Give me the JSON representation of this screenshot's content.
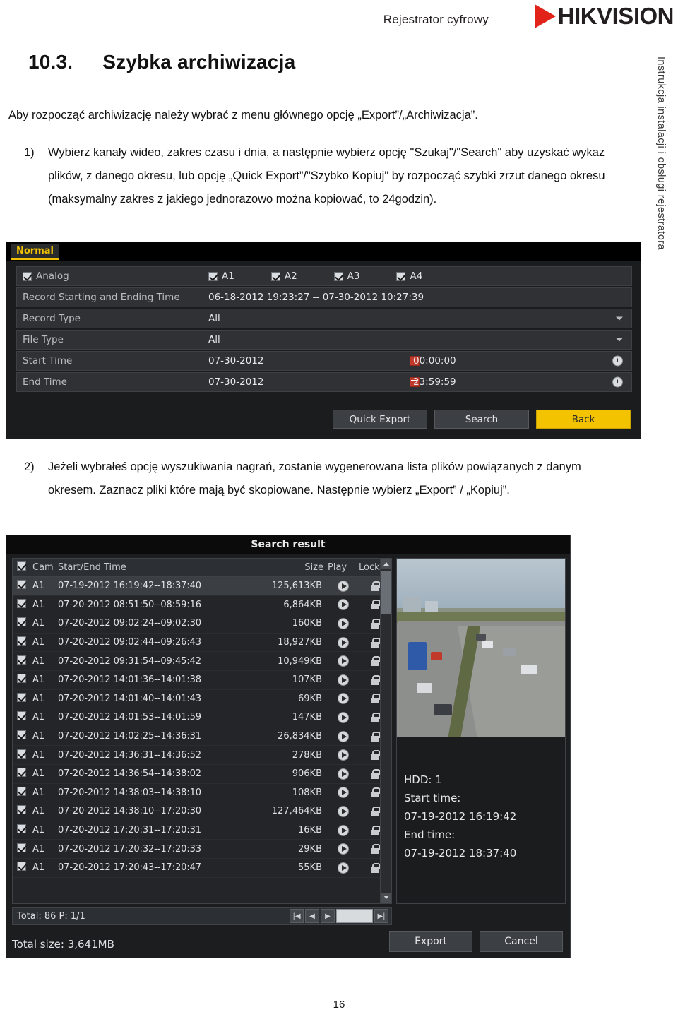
{
  "header": {
    "product_text": "Rejestrator  cyfrowy",
    "brand": "HIKVISION",
    "side_text": "Instrukcja instalacji i obsługi rejestratora"
  },
  "title": {
    "number": "10.3.",
    "text": "Szybka archiwizacja"
  },
  "lead": "Aby rozpocząć archiwizację należy wybrać z menu głównego opcję „Export”/„Archiwizacja”.",
  "item1": {
    "marker": "1)",
    "text": "Wybierz kanały wideo, zakres czasu i dnia, a następnie wybierz opcję \"Szukaj\"/\"Search\" aby uzyskać wykaz plików, z danego okresu, lub opcję „Quick Export”/\"Szybko Kopiuj\" by rozpocząć szybki zrzut danego okresu (maksymalny zakres z jakiego jednorazowo można kopiować, to 24godzin)."
  },
  "item2": {
    "marker": "2)",
    "text": "Jeżeli wybrałeś opcję wyszukiwania nagrań, zostanie wygenerowana lista plików powiązanych z danym okresem. Zaznacz pliki które mają być skopiowane. Następnie wybierz „Export” / „Kopiuj”."
  },
  "export_panel": {
    "tab": "Normal",
    "analog_label": "Analog",
    "channels": [
      "A1",
      "A2",
      "A3",
      "A4"
    ],
    "rows": [
      {
        "label": "Record Starting and Ending Time",
        "value": "06-18-2012 19:23:27  --  07-30-2012 10:27:39"
      },
      {
        "label": "Record Type",
        "value": "All"
      },
      {
        "label": "File Type",
        "value": "All"
      },
      {
        "label": "Start Time",
        "value": "07-30-2012",
        "time": "00:00:00"
      },
      {
        "label": "End Time",
        "value": "07-30-2012",
        "time": "23:59:59"
      }
    ],
    "buttons": {
      "quick_export": "Quick Export",
      "search": "Search",
      "back": "Back"
    }
  },
  "search_window": {
    "title": "Search result",
    "columns": {
      "cam": "Cam",
      "time": "Start/End Time",
      "size": "Size",
      "play": "Play",
      "lock": "Lock"
    },
    "rows": [
      {
        "cam": "A1",
        "time": "07-19-2012 16:19:42--18:37:40",
        "size": "125,613KB"
      },
      {
        "cam": "A1",
        "time": "07-20-2012 08:51:50--08:59:16",
        "size": "6,864KB"
      },
      {
        "cam": "A1",
        "time": "07-20-2012 09:02:24--09:02:30",
        "size": "160KB"
      },
      {
        "cam": "A1",
        "time": "07-20-2012 09:02:44--09:26:43",
        "size": "18,927KB"
      },
      {
        "cam": "A1",
        "time": "07-20-2012 09:31:54--09:45:42",
        "size": "10,949KB"
      },
      {
        "cam": "A1",
        "time": "07-20-2012 14:01:36--14:01:38",
        "size": "107KB"
      },
      {
        "cam": "A1",
        "time": "07-20-2012 14:01:40--14:01:43",
        "size": "69KB"
      },
      {
        "cam": "A1",
        "time": "07-20-2012 14:01:53--14:01:59",
        "size": "147KB"
      },
      {
        "cam": "A1",
        "time": "07-20-2012 14:02:25--14:36:31",
        "size": "26,834KB"
      },
      {
        "cam": "A1",
        "time": "07-20-2012 14:36:31--14:36:52",
        "size": "278KB"
      },
      {
        "cam": "A1",
        "time": "07-20-2012 14:36:54--14:38:02",
        "size": "906KB"
      },
      {
        "cam": "A1",
        "time": "07-20-2012 14:38:03--14:38:10",
        "size": "108KB"
      },
      {
        "cam": "A1",
        "time": "07-20-2012 14:38:10--17:20:30",
        "size": "127,464KB"
      },
      {
        "cam": "A1",
        "time": "07-20-2012 17:20:31--17:20:31",
        "size": "16KB"
      },
      {
        "cam": "A1",
        "time": "07-20-2012 17:20:32--17:20:33",
        "size": "29KB"
      },
      {
        "cam": "A1",
        "time": "07-20-2012 17:20:43--17:20:47",
        "size": "55KB"
      }
    ],
    "total": "Total: 86  P: 1/1",
    "total_size": "Total size: 3,641MB",
    "hdd_label": "HDD: 1",
    "start_time_label": "Start time:",
    "start_time_value": "07-19-2012 16:19:42",
    "end_time_label": "End time:",
    "end_time_value": "07-19-2012 18:37:40",
    "buttons": {
      "export": "Export",
      "cancel": "Cancel"
    }
  },
  "footer": {
    "page": "16"
  }
}
